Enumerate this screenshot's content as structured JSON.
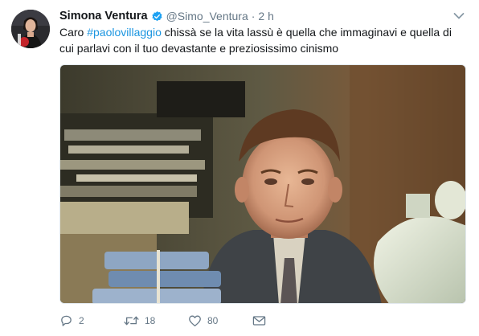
{
  "tweet": {
    "author": {
      "name": "Simona Ventura",
      "handle": "@Simo_Ventura",
      "verified": true,
      "avatar": "avatar-photo"
    },
    "separator": "·",
    "time": "2 h",
    "text": {
      "before": "Caro ",
      "hashtag": "#paolovillaggio",
      "after": " chissà se la vita lassù è quella che immaginavi e quella di cui parlavi con il tuo devastante e preziosissimo cinismo"
    },
    "media": {
      "kind": "photo",
      "description_icon": "photo-of-man-behind-stacks-of-files"
    },
    "actions": {
      "replies": "2",
      "retweets": "18",
      "likes": "80",
      "reply_icon": "reply-icon",
      "retweet_icon": "retweet-icon",
      "like_icon": "heart-icon",
      "dm_icon": "envelope-icon"
    },
    "colors": {
      "link": "#1b95e0",
      "muted": "#657786",
      "verified": "#1da1f2"
    }
  }
}
